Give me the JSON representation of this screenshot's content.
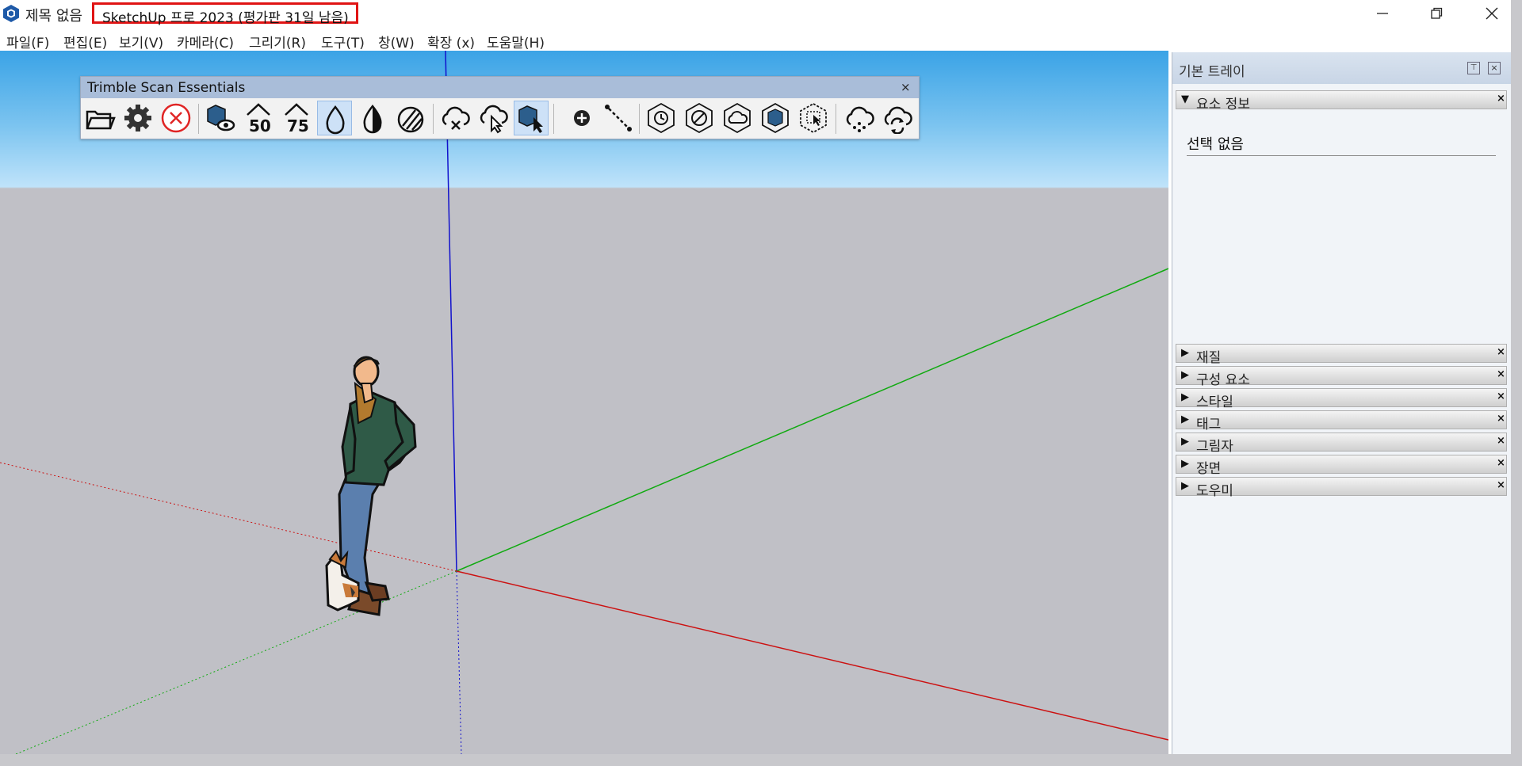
{
  "window": {
    "doc_title": "제목 없음",
    "app_title": "SketchUp 프로 2023 (평가판 31일 남음)"
  },
  "menu": [
    {
      "label": "파일(F)"
    },
    {
      "label": "편집(E)"
    },
    {
      "label": "보기(V)"
    },
    {
      "label": "카메라(C)"
    },
    {
      "label": "그리기(R)"
    },
    {
      "label": "도구(T)"
    },
    {
      "label": "창(W)"
    },
    {
      "label": "확장 (x)"
    },
    {
      "label": "도움말(H)"
    }
  ],
  "toolbar": {
    "title": "Trimble Scan Essentials",
    "close_glyph": "×",
    "tools": [
      {
        "icon": "folder-open-icon"
      },
      {
        "icon": "gear-icon"
      },
      {
        "icon": "cancel-circle-icon"
      },
      {
        "icon": "scan-view-icon"
      },
      {
        "icon": "density-50-icon"
      },
      {
        "icon": "density-75-icon"
      },
      {
        "icon": "drop-icon",
        "active": true
      },
      {
        "icon": "contrast-icon"
      },
      {
        "icon": "hatch-icon"
      },
      {
        "icon": "cloud-remove-icon"
      },
      {
        "icon": "cloud-pick-icon"
      },
      {
        "icon": "scan-pick-icon",
        "active": true
      },
      {
        "icon": "add-point-icon"
      },
      {
        "icon": "dashed-line-icon"
      },
      {
        "icon": "hex-history-icon"
      },
      {
        "icon": "hex-disabled-icon"
      },
      {
        "icon": "hex-cloud-icon"
      },
      {
        "icon": "hex-scan-icon"
      },
      {
        "icon": "hex-select-icon"
      },
      {
        "icon": "cloud-points-icon"
      },
      {
        "icon": "cloud-sync-icon"
      }
    ]
  },
  "tray": {
    "title": "기본 트레이",
    "pin_glyph": "⊤",
    "close_glyph": "×",
    "entity_info": {
      "label": "요소 정보",
      "value": "선택 없음"
    },
    "panels": [
      {
        "label": "재질"
      },
      {
        "label": "구성 요소"
      },
      {
        "label": "스타일"
      },
      {
        "label": "태그"
      },
      {
        "label": "그림자"
      },
      {
        "label": "장면"
      },
      {
        "label": "도우미"
      }
    ],
    "expanded_arrow": "▼",
    "collapsed_arrow": "▶",
    "panel_close_glyph": "×"
  },
  "colors": {
    "axis_red": "#cc1111",
    "axis_green": "#11aa11",
    "axis_blue": "#1111cc",
    "highlight": "#e01414"
  }
}
